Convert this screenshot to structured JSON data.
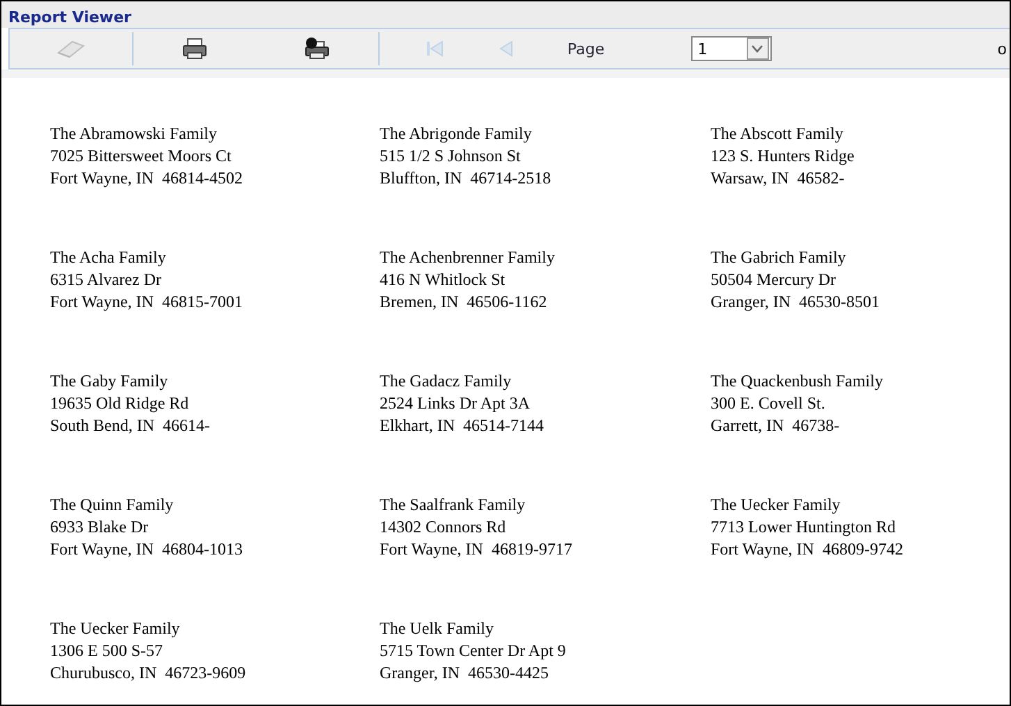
{
  "window": {
    "title": "Report Viewer"
  },
  "toolbar": {
    "groups": [
      {
        "buttons": [
          {
            "kind": "eraser",
            "disabled": true
          }
        ]
      },
      {
        "buttons": [
          {
            "kind": "print",
            "disabled": false
          },
          {
            "kind": "print-one",
            "disabled": false
          }
        ]
      },
      {
        "buttons": [
          {
            "kind": "first",
            "disabled": true
          },
          {
            "kind": "prev",
            "disabled": true
          }
        ]
      }
    ],
    "page_label": "Page",
    "page_select": {
      "value": "1"
    },
    "trailing": "o"
  },
  "labels": [
    {
      "name": "The Abramowski Family",
      "street": "7025 Bittersweet Moors Ct",
      "city": "Fort Wayne, IN  46814-4502"
    },
    {
      "name": "The Abrigonde Family",
      "street": "515 1/2 S Johnson St",
      "city": "Bluffton, IN  46714-2518"
    },
    {
      "name": "The Abscott Family",
      "street": "123 S. Hunters Ridge",
      "city": "Warsaw, IN  46582-"
    },
    {
      "name": "The Acha Family",
      "street": "6315 Alvarez Dr",
      "city": "Fort Wayne, IN  46815-7001"
    },
    {
      "name": "The Achenbrenner Family",
      "street": "416 N Whitlock St",
      "city": "Bremen, IN  46506-1162"
    },
    {
      "name": "The Gabrich Family",
      "street": "50504 Mercury Dr",
      "city": "Granger, IN  46530-8501"
    },
    {
      "name": "The Gaby Family",
      "street": "19635 Old Ridge Rd",
      "city": "South Bend, IN  46614-"
    },
    {
      "name": "The Gadacz Family",
      "street": "2524 Links Dr Apt 3A",
      "city": "Elkhart, IN  46514-7144"
    },
    {
      "name": "The Quackenbush Family",
      "street": "300 E. Covell St.",
      "city": "Garrett, IN  46738-"
    },
    {
      "name": "The Quinn Family",
      "street": "6933 Blake Dr",
      "city": "Fort Wayne, IN  46804-1013"
    },
    {
      "name": "The Saalfrank Family",
      "street": "14302 Connors Rd",
      "city": "Fort Wayne, IN  46819-9717"
    },
    {
      "name": "The Uecker Family",
      "street": "7713 Lower Huntington Rd",
      "city": "Fort Wayne, IN  46809-9742"
    },
    {
      "name": "The Uecker Family",
      "street": "1306 E 500 S-57",
      "city": "Churubusco, IN  46723-9609"
    },
    {
      "name": "The Uelk Family",
      "street": "5715 Town Center Dr Apt 9",
      "city": "Granger, IN  46530-4425"
    }
  ]
}
